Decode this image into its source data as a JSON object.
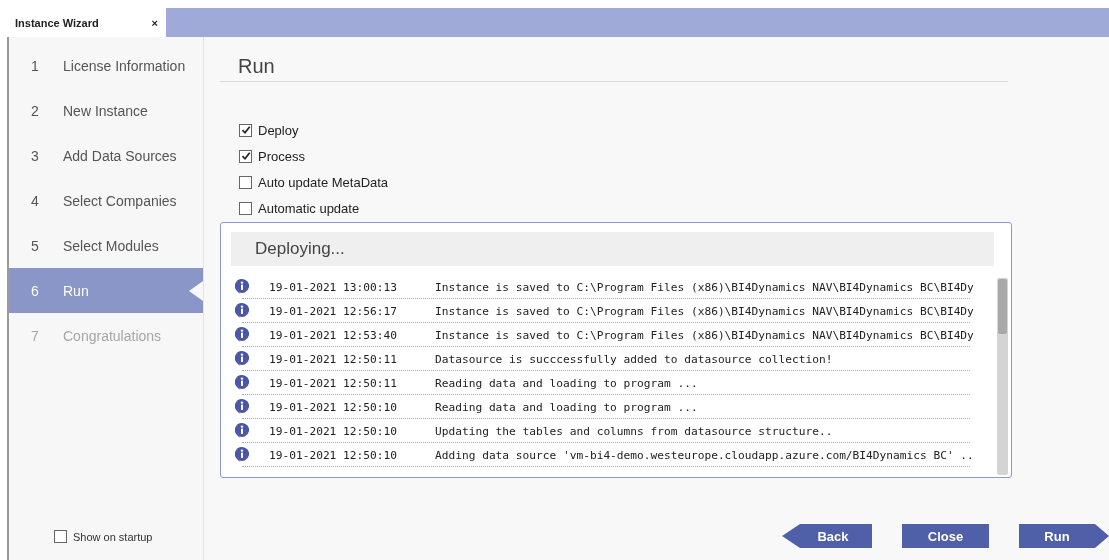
{
  "tab": {
    "title": "Instance Wizard",
    "close": "×"
  },
  "steps": [
    {
      "number": "1",
      "label": "License Information",
      "selected": false,
      "disabled": false
    },
    {
      "number": "2",
      "label": "New Instance",
      "selected": false,
      "disabled": false
    },
    {
      "number": "3",
      "label": "Add Data Sources",
      "selected": false,
      "disabled": false
    },
    {
      "number": "4",
      "label": "Select Companies",
      "selected": false,
      "disabled": false
    },
    {
      "number": "5",
      "label": "Select Modules",
      "selected": false,
      "disabled": false
    },
    {
      "number": "6",
      "label": "Run",
      "selected": true,
      "disabled": false
    },
    {
      "number": "7",
      "label": "Congratulations",
      "selected": false,
      "disabled": true
    }
  ],
  "show_on_startup": {
    "label": "Show on startup",
    "checked": false
  },
  "page_title": "Run",
  "options": [
    {
      "label": "Deploy",
      "checked": true
    },
    {
      "label": "Process",
      "checked": true
    },
    {
      "label": "Auto update MetaData",
      "checked": false
    },
    {
      "label": "Automatic update",
      "checked": false
    }
  ],
  "log": {
    "title": "Deploying...",
    "rows": [
      {
        "time": "19-01-2021 13:00:13",
        "message": "Instance is saved to C:\\Program Files (x86)\\BI4Dynamics NAV\\BI4Dynamics BC\\BI4Dy"
      },
      {
        "time": "19-01-2021 12:56:17",
        "message": "Instance is saved to C:\\Program Files (x86)\\BI4Dynamics NAV\\BI4Dynamics BC\\BI4Dy"
      },
      {
        "time": "19-01-2021 12:53:40",
        "message": "Instance is saved to C:\\Program Files (x86)\\BI4Dynamics NAV\\BI4Dynamics BC\\BI4Dy"
      },
      {
        "time": "19-01-2021 12:50:11",
        "message": "Datasource is succcessfully added to datasource collection!"
      },
      {
        "time": "19-01-2021 12:50:11",
        "message": "Reading data and loading to program ..."
      },
      {
        "time": "19-01-2021 12:50:10",
        "message": "Reading data and loading to program ..."
      },
      {
        "time": "19-01-2021 12:50:10",
        "message": "Updating the tables and columns from datasource structure.."
      },
      {
        "time": "19-01-2021 12:50:10",
        "message": "Adding data source 'vm-bi4-demo.westeurope.cloudapp.azure.com/BI4Dynamics BC' .."
      }
    ]
  },
  "buttons": [
    {
      "label": "Back",
      "kind": "back"
    },
    {
      "label": "Close",
      "kind": "plain"
    },
    {
      "label": "Run",
      "kind": "next"
    }
  ]
}
